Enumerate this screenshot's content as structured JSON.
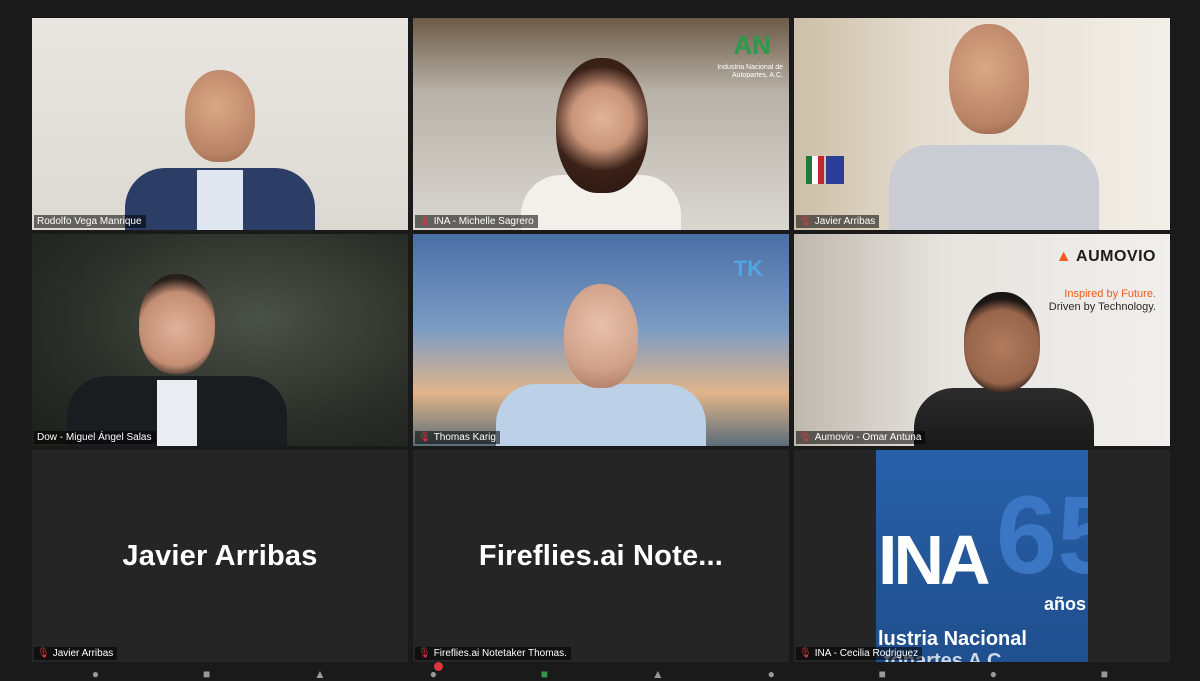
{
  "participants": [
    {
      "id": "p1",
      "name": "Rodolfo Vega Manrique",
      "muted": false
    },
    {
      "id": "p2",
      "name": "INA - Michelle Sagrero",
      "muted": true
    },
    {
      "id": "p3",
      "name": "Javier Arribas",
      "muted": true
    },
    {
      "id": "p4",
      "name": "Dow - Miguel Ángel Salas",
      "muted": false,
      "active_speaker": true
    },
    {
      "id": "p5",
      "name": "Thomas Karig",
      "muted": true
    },
    {
      "id": "p6",
      "name": "Aumovio - Omar Antuna",
      "muted": true
    },
    {
      "id": "p7",
      "name": "Javier Arribas",
      "muted": true,
      "video_off": true,
      "display_name": "Javier Arribas"
    },
    {
      "id": "p8",
      "name": "Fireflies.ai Notetaker Thomas.",
      "muted": true,
      "video_off": true,
      "display_name": "Fireflies.ai  Note..."
    },
    {
      "id": "p9",
      "name": "INA - Cecilia Rodriguez",
      "muted": true
    }
  ],
  "backgrounds": {
    "aumovio": {
      "brand": "AUMOVIO",
      "tagline_1": "Inspired by Future.",
      "tagline_2": "Driven by Technology."
    },
    "thomas": {
      "badge": "TK"
    },
    "ina_office": {
      "logo": "AN",
      "logo_sub": "Industria Nacional de Autopartes, A.C."
    },
    "ina_65": {
      "ina": "INA",
      "number": "65",
      "anos": "años",
      "line1": "lustria Nacional",
      "line2": "tonartes A C"
    }
  },
  "toolbar": {
    "notification_count": "1"
  },
  "colors": {
    "active_border": "#e8e07a",
    "mic_off": "#e0353b",
    "grid_bg": "#1a1a1a"
  }
}
